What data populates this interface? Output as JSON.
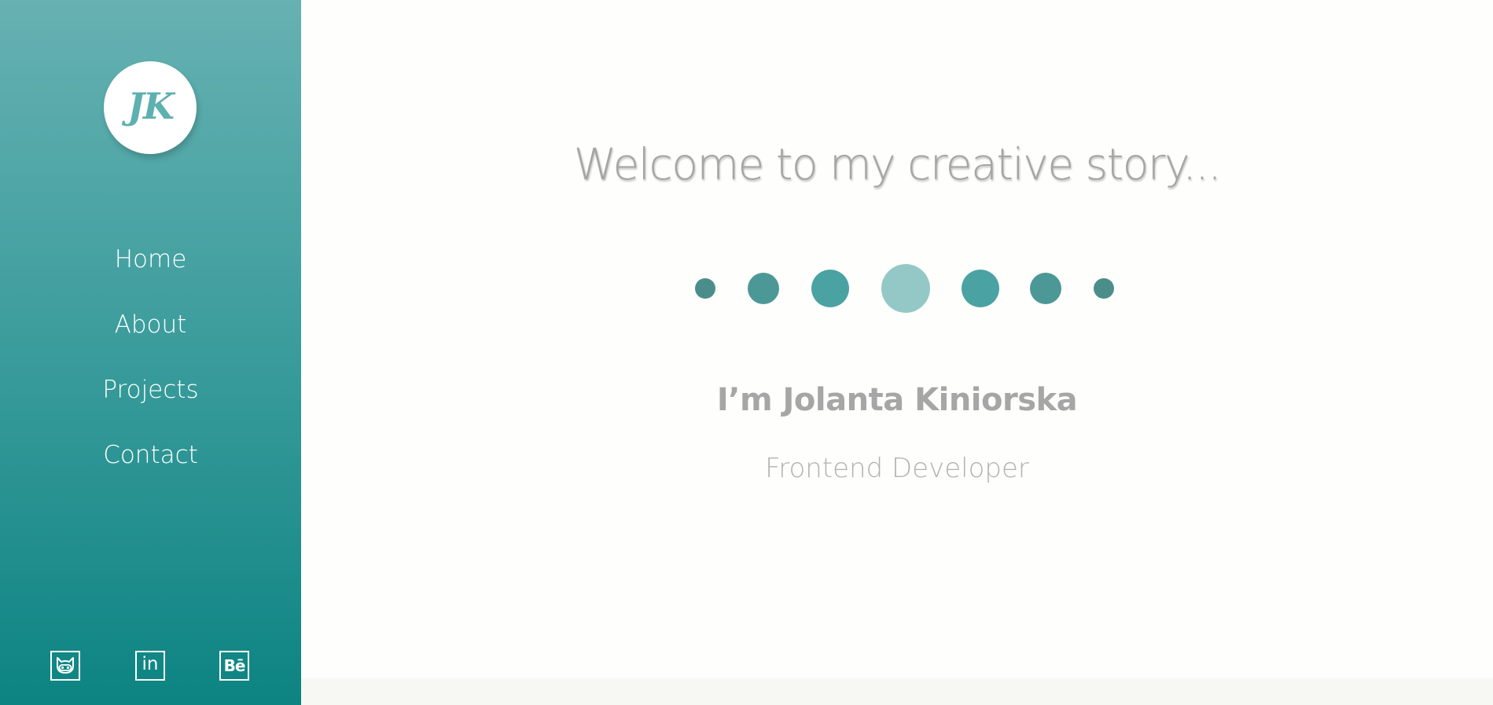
{
  "sidebar": {
    "logo_text": "JK",
    "nav": [
      {
        "label": "Home"
      },
      {
        "label": "About"
      },
      {
        "label": "Projects"
      },
      {
        "label": "Contact"
      }
    ],
    "socials": [
      {
        "icon": "github-icon"
      },
      {
        "icon": "linkedin-icon",
        "text": "in"
      },
      {
        "icon": "behance-icon",
        "text": "Bē"
      }
    ]
  },
  "main": {
    "headline": "Welcome to my creative story...",
    "name": "I’m Jolanta Kiniorska",
    "role": "Frontend Developer"
  },
  "colors": {
    "sidebar_top": "#67b1b2",
    "sidebar_bottom": "#0c8482",
    "text_gray": "#a5a5a5",
    "dot_dark": "#4b8d8b",
    "dot_mid": "#4aa3a2",
    "dot_light": "#94c8c6"
  }
}
